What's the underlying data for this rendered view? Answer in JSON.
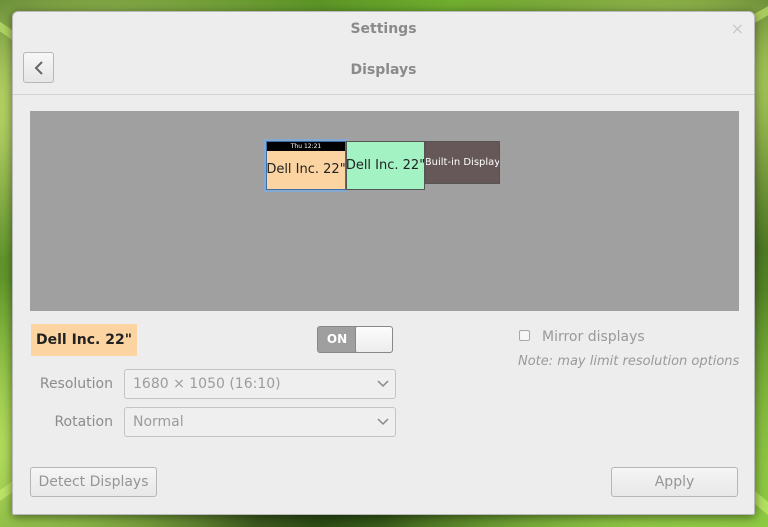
{
  "window": {
    "title": "Settings",
    "close_glyph": "×"
  },
  "header": {
    "back_icon": "chevron-left-icon",
    "subtitle": "Displays"
  },
  "arrangement": {
    "monitors": [
      {
        "label": "Dell Inc. 22\"",
        "clock": "Thu 12:21",
        "color": "#fcd4a1",
        "primary": true
      },
      {
        "label": "Dell Inc. 22\"",
        "color": "#a3f2c4"
      },
      {
        "label": "Built-in Display",
        "color": "#665858"
      }
    ]
  },
  "selected": {
    "name": "Dell Inc. 22\"",
    "color": "#fcd4a1"
  },
  "switch": {
    "label": "ON"
  },
  "settings": {
    "resolution": {
      "label": "Resolution",
      "value": "1680 × 1050 (16:10)"
    },
    "rotation": {
      "label": "Rotation",
      "value": "Normal"
    }
  },
  "mirror": {
    "label": "Mirror displays",
    "note": "Note: may limit resolution options"
  },
  "footer": {
    "detect_label": "Detect Displays",
    "apply_label": "Apply"
  }
}
